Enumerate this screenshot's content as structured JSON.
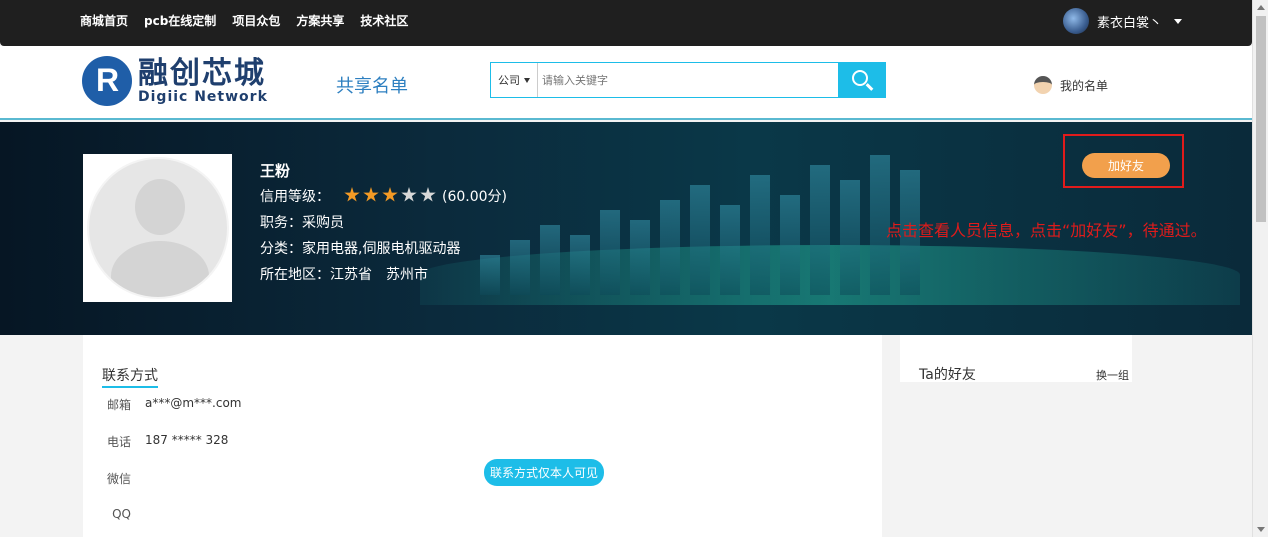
{
  "topnav": [
    "商城首页",
    "pcb在线定制",
    "项目众包",
    "方案共享",
    "技术社区"
  ],
  "user": {
    "name": "素衣白裳丶"
  },
  "logo": {
    "cn": "融创芯城",
    "en": "Digiic Network"
  },
  "header": {
    "share_title": "共享名单",
    "my_list": "我的名单"
  },
  "search": {
    "scope": "公司",
    "placeholder": "请输入关键字"
  },
  "profile": {
    "name": "王粉",
    "credit_label": "信用等级：",
    "stars_on": 3,
    "stars_total": 5,
    "score": "(60.00分)",
    "position": "职务：采购员",
    "category": "分类：家用电器,伺服电机驱动器",
    "region": "所在地区：江苏省　苏州市",
    "add_friend": "加好友"
  },
  "annotation": "点击查看人员信息，点击“加好友”，待通过。",
  "contact": {
    "title": "联系方式",
    "email_label": "邮箱",
    "email": "a***@m***.com",
    "phone_label": "电话",
    "phone": "187 ***** 328",
    "wechat_label": "微信",
    "qq_label": "QQ",
    "visible_note": "联系方式仅本人可见"
  },
  "friends": {
    "title": "Ta的好友",
    "change": "换一组"
  },
  "colors": {
    "accent": "#1dbde8",
    "star": "#f39a25",
    "add_button": "#f2a04c",
    "annotation": "#e01b1b"
  }
}
